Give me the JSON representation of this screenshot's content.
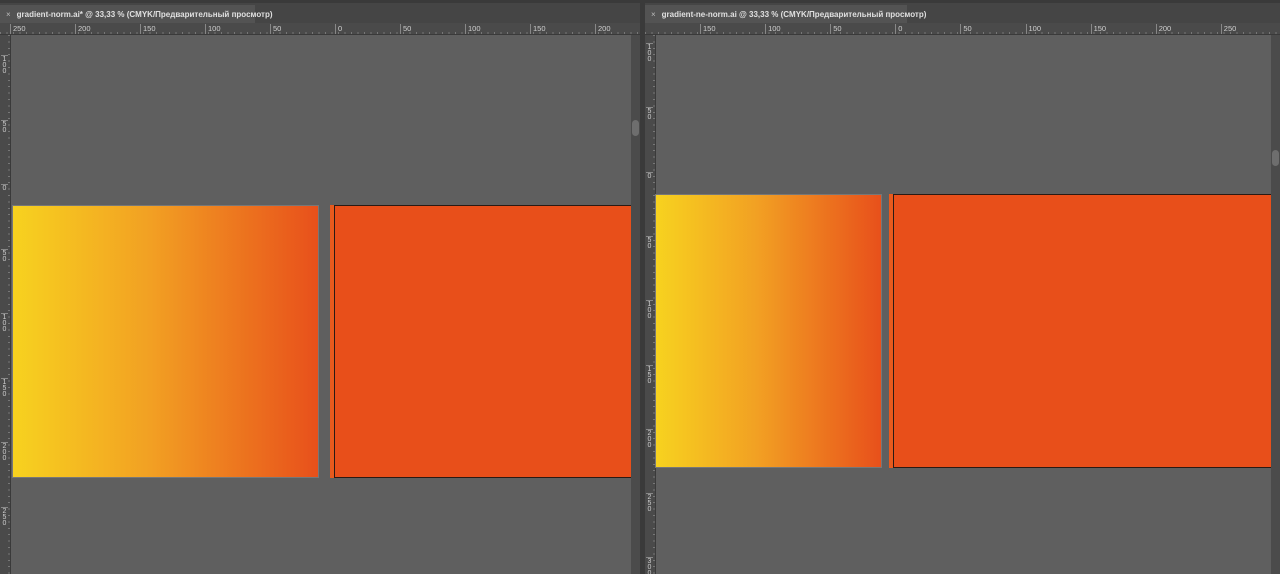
{
  "left_document": {
    "tab_close": "×",
    "tab_title": "gradient-norm.ai* @ 33,33 % (CMYK/Предварительный просмотр)",
    "hruler_labels": [
      "250",
      "200",
      "150",
      "100",
      "50",
      "0",
      "50",
      "100",
      "150",
      "200"
    ],
    "vruler_labels": [
      "100",
      "50",
      "0",
      "50",
      "100",
      "150",
      "200",
      "250"
    ]
  },
  "right_document": {
    "tab_close": "×",
    "tab_title": "gradient-ne-norm.ai @ 33,33 % (CMYK/Предварительный просмотр)",
    "hruler_labels": [
      "150",
      "100",
      "50",
      "0",
      "50",
      "100",
      "150",
      "200",
      "250"
    ],
    "vruler_labels": [
      "100",
      "50",
      "0",
      "50",
      "100",
      "150",
      "200",
      "250",
      "300"
    ]
  },
  "colors": {
    "gradient_start": "#f7d21f",
    "gradient_end": "#e8501b",
    "solid_fill": "#e84f1a",
    "canvas": "#5f5f5f"
  }
}
